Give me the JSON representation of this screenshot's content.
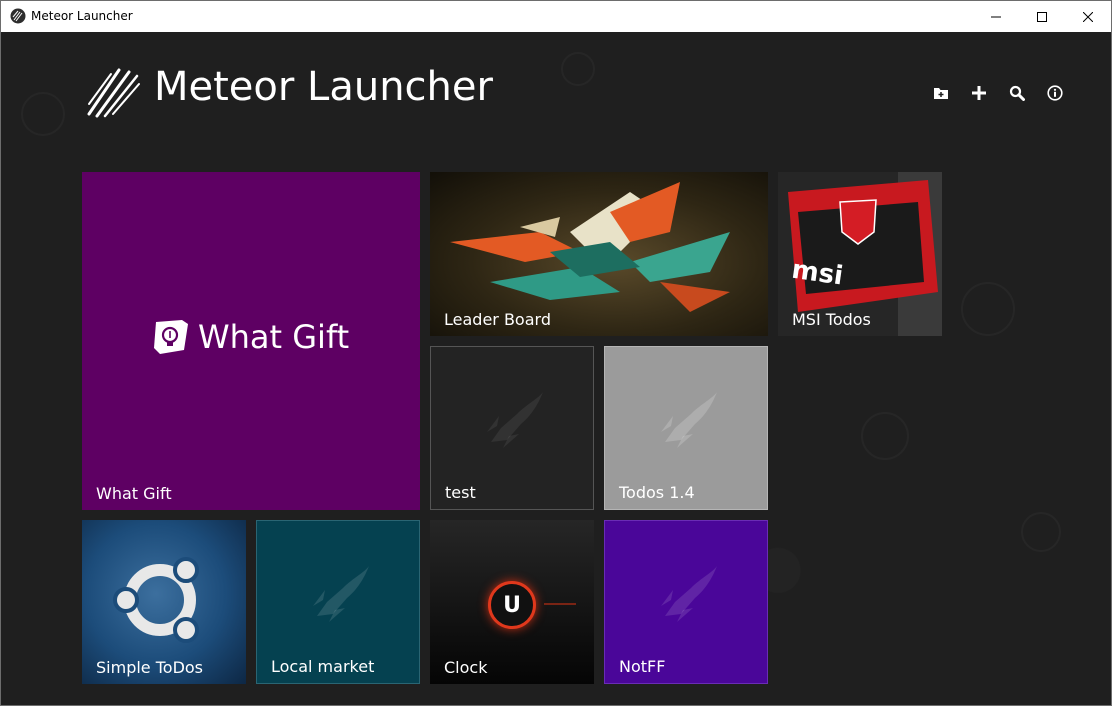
{
  "window": {
    "title": "Meteor Launcher",
    "controls": [
      "minimize-icon",
      "maximize-icon",
      "close-icon"
    ]
  },
  "header": {
    "app_name": "Meteor Launcher",
    "logo_icon": "meteor-logo-icon",
    "toolbar": [
      {
        "name": "open-folder-button",
        "icon": "folder-icon"
      },
      {
        "name": "add-app-button",
        "icon": "plus-icon"
      },
      {
        "name": "search-button",
        "icon": "search-icon"
      },
      {
        "name": "about-button",
        "icon": "info-icon"
      }
    ]
  },
  "tiles": [
    {
      "label": "What Gift",
      "logo_text": "What Gift",
      "background": "#5e0063"
    },
    {
      "label": "Leader Board",
      "background": "#2a2418"
    },
    {
      "label": "MSI Todos",
      "background": "#2b2b2b"
    },
    {
      "label": "test",
      "background": "#232323",
      "icon": "rocket-icon"
    },
    {
      "label": "Todos 1.4",
      "background": "#9b9b9b",
      "icon": "rocket-icon"
    },
    {
      "label": "Simple ToDos",
      "background": "#1c4c7a"
    },
    {
      "label": "Local market",
      "background": "#054150",
      "icon": "rocket-icon"
    },
    {
      "label": "Clock",
      "background": "#0e0e0e",
      "logo_text": "U"
    },
    {
      "label": "NotFF",
      "background": "#4a0699",
      "icon": "rocket-icon"
    }
  ]
}
